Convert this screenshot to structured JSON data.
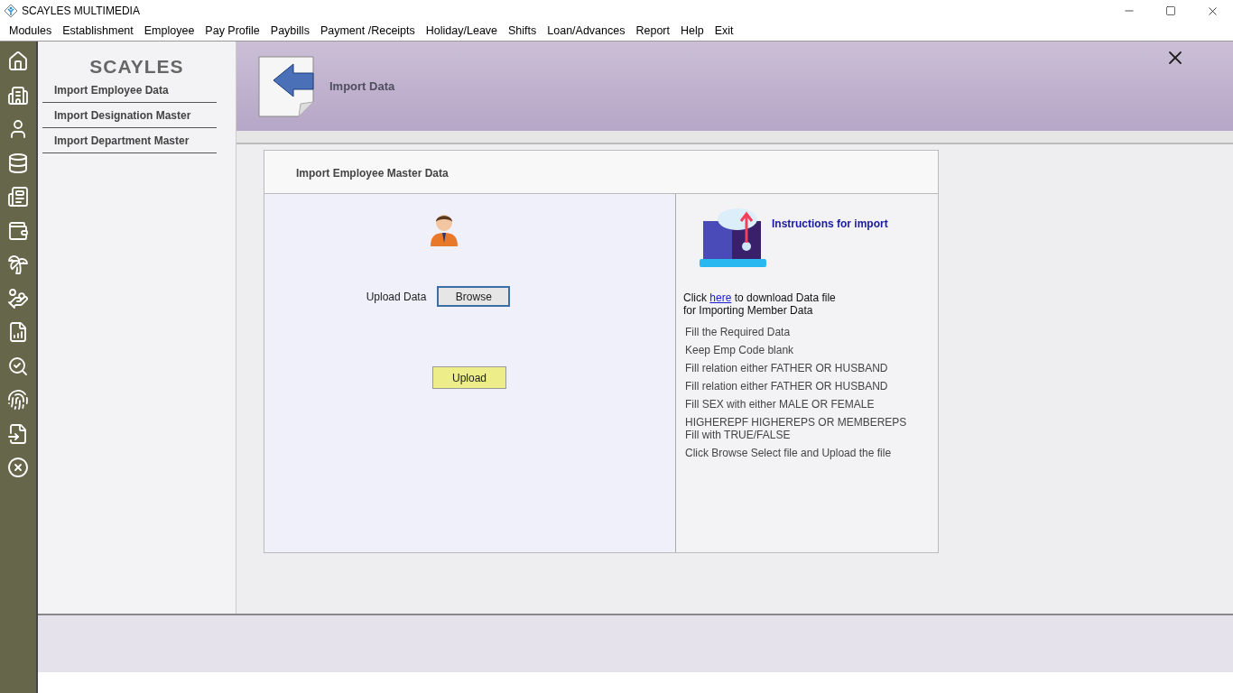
{
  "window": {
    "title": "SCAYLES MULTIMEDIA"
  },
  "menu": [
    "Modules",
    "Establishment",
    "Employee",
    "Pay Profile",
    "Paybills",
    "Payment /Receipts",
    "Holiday/Leave",
    "Shifts",
    "Loan/Advances",
    "Report",
    "Help",
    "Exit"
  ],
  "logo": {
    "text": "SCAYLES"
  },
  "sidebar": {
    "items": [
      {
        "label": "Import Employee Data"
      },
      {
        "label": "Import Designation Master"
      },
      {
        "label": "Import Department Master"
      }
    ]
  },
  "header": {
    "title": "Import Data"
  },
  "card": {
    "title": "Import Employee Master Data",
    "upload_label": "Upload Data",
    "browse_button": "Browse",
    "upload_button": "Upload",
    "instructions_title": "Instructions for import",
    "download_before": "Click ",
    "download_link": "here",
    "download_after": " to download Data file",
    "download_line2": "for Importing Member Data",
    "instructions": [
      "Fill the Required Data",
      "Keep Emp Code blank",
      "Fill relation either FATHER OR HUSBAND",
      "Fill relation either FATHER OR HUSBAND",
      "Fill SEX with either MALE  OR FEMALE",
      "HIGHEREPF HIGHEREPS OR MEMBEREPS\nFill with  TRUE/FALSE",
      "Click Browse Select file and Upload the file"
    ]
  }
}
